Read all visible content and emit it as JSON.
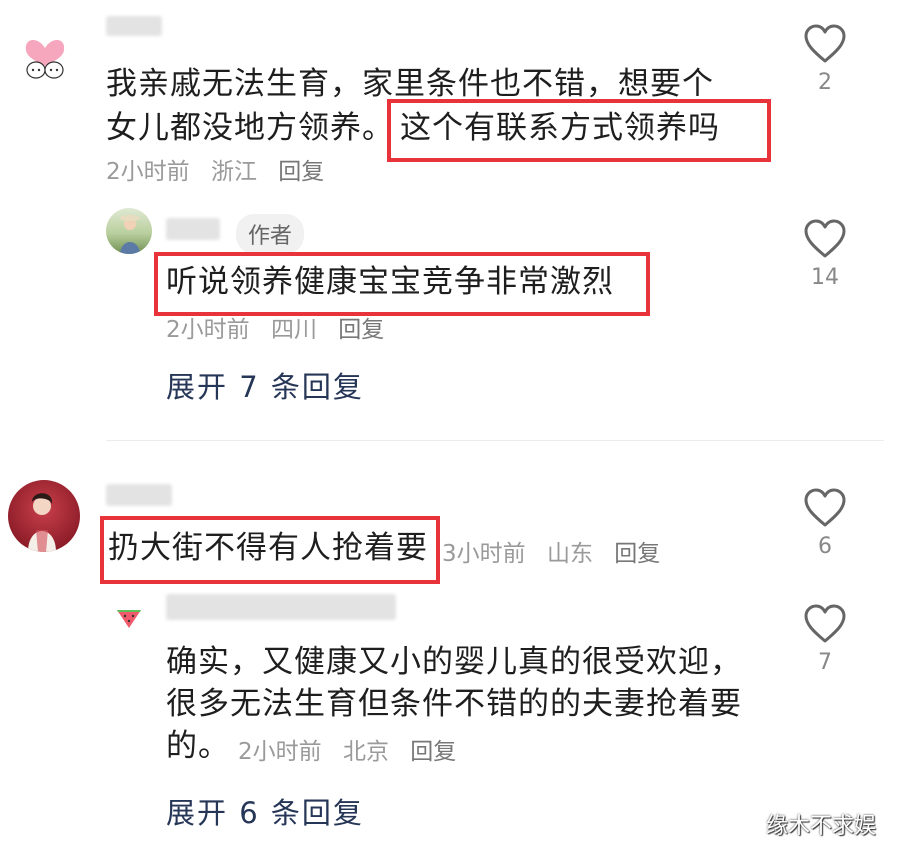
{
  "comments": [
    {
      "text_line1": "我亲戚无法生育，家里条件也不错，想要个",
      "text_line2_prefix": "女儿都没地方领养。",
      "text_highlight": "这个有联系方式领养吗",
      "time": "2小时前",
      "location": "浙江",
      "reply_label": "回复",
      "likes": "2",
      "reply": {
        "author_badge": "作者",
        "text_highlight": "听说领养健康宝宝竞争非常激烈",
        "time": "2小时前",
        "location": "四川",
        "reply_label": "回复",
        "likes": "14"
      },
      "expand_label": "展开 7 条回复"
    },
    {
      "text_highlight": "扔大街不得有人抢着要",
      "time": "3小时前",
      "location": "山东",
      "reply_label": "回复",
      "likes": "6",
      "reply": {
        "text_line1": "确实，又健康又小的婴儿真的很受欢迎，",
        "text_line2": "很多无法生育但条件不错的的夫妻抢着要",
        "text_line3": "的。",
        "time": "2小时前",
        "location": "北京",
        "reply_label": "回复",
        "likes": "7"
      },
      "expand_label": "展开 6 条回复"
    }
  ],
  "watermark": "缘木不求娱",
  "colors": {
    "highlight_border": "#e8333a",
    "expand_text": "#263657",
    "meta_text": "#9a9a9a"
  }
}
